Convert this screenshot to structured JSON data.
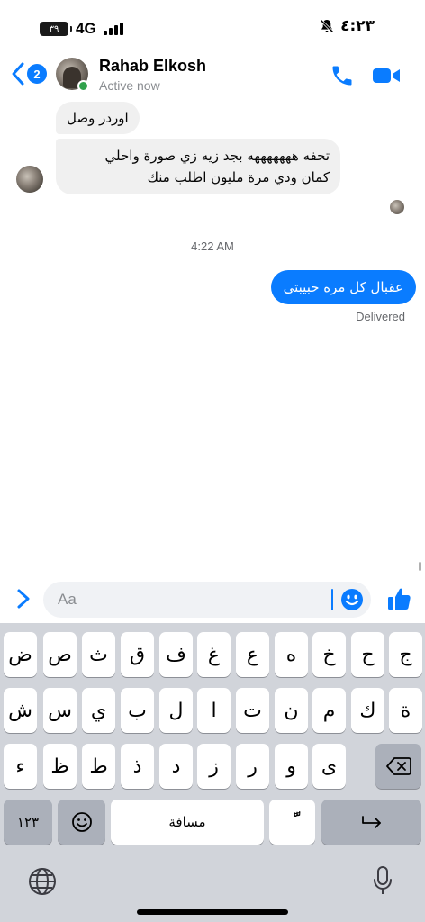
{
  "status_bar": {
    "battery": "٣٩",
    "network": "4G",
    "time": "٤:٢٣"
  },
  "header": {
    "back_badge": "2",
    "contact_name": "Rahab Elkosh",
    "contact_status": "Active now",
    "icons": {
      "call": "phone-icon",
      "video": "video-camera-icon",
      "back": "chevron-left-icon"
    }
  },
  "thread": {
    "incoming": [
      {
        "lines": [
          "اوردر وصل"
        ]
      },
      {
        "lines": [
          "تحفه هههههههه بجد زيه زي صورة واحلي",
          "كمان ودي مرة مليون اطلب منك"
        ]
      }
    ],
    "timestamp": "4:22 AM",
    "outgoing": [
      {
        "text": "عقبال كل مره حبيبتى"
      }
    ],
    "delivery_status": "Delivered"
  },
  "composer": {
    "placeholder": "Aa",
    "icons": {
      "expand": "chevron-right-icon",
      "emoji": "emoji-icon",
      "like": "thumbs-up-icon"
    }
  },
  "keyboard": {
    "row1": [
      "ض",
      "ص",
      "ث",
      "ق",
      "ف",
      "غ",
      "ع",
      "ه",
      "خ",
      "ح",
      "ج"
    ],
    "row2": [
      "ش",
      "س",
      "ي",
      "ب",
      "ل",
      "ا",
      "ت",
      "ن",
      "م",
      "ك",
      "ة"
    ],
    "row3": [
      "ء",
      "ظ",
      "ط",
      "ذ",
      "د",
      "ز",
      "ر",
      "و",
      "ى"
    ],
    "numbers_key": "١٢٣",
    "space_key": "مسافة",
    "diacritic_key": "ًّ",
    "icons": {
      "backspace": "backspace-icon",
      "emoji": "emoji-icon",
      "return": "return-icon",
      "globe": "globe-icon",
      "mic": "microphone-icon"
    }
  },
  "colors": {
    "accent": "#0a7cff",
    "incoming_bubble": "#f0f0f0",
    "online": "#31a24c",
    "keyboard_bg": "#d1d4da"
  }
}
